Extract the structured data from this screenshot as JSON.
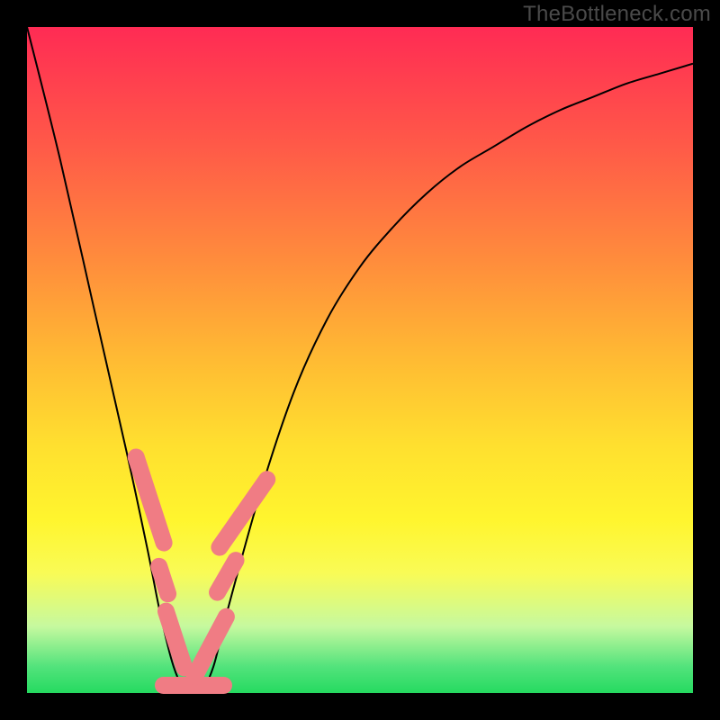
{
  "watermark": "TheBottleneck.com",
  "chart_data": {
    "type": "line",
    "title": "",
    "xlabel": "",
    "ylabel": "",
    "xlim": [
      0,
      100
    ],
    "ylim": [
      0,
      100
    ],
    "series": [
      {
        "name": "bottleneck-curve",
        "x": [
          0,
          5,
          10,
          15,
          18,
          20,
          22,
          24,
          26,
          28,
          30,
          35,
          40,
          45,
          50,
          55,
          60,
          65,
          70,
          75,
          80,
          85,
          90,
          95,
          100
        ],
        "y": [
          100,
          80,
          58,
          36,
          22,
          12,
          4,
          0,
          0,
          4,
          12,
          30,
          45,
          56,
          64,
          70,
          75,
          79,
          82,
          85,
          87.5,
          89.5,
          91.5,
          93,
          94.5
        ]
      }
    ],
    "annotations": [
      {
        "name": "zone-left-upper",
        "x": 18.5,
        "y_center": 29,
        "length": 14,
        "angle": -72
      },
      {
        "name": "zone-left-mid",
        "x": 20.5,
        "y_center": 17,
        "length": 6,
        "angle": -72
      },
      {
        "name": "zone-left-lower",
        "x": 22.3,
        "y_center": 8,
        "length": 10,
        "angle": -72
      },
      {
        "name": "zone-trough",
        "x": 25,
        "y_center": 1.2,
        "length": 10,
        "angle": 0
      },
      {
        "name": "zone-right-lower",
        "x": 27.5,
        "y_center": 7,
        "length": 11,
        "angle": 62
      },
      {
        "name": "zone-right-mid",
        "x": 30,
        "y_center": 17.5,
        "length": 7,
        "angle": 60
      },
      {
        "name": "zone-right-upper",
        "x": 32.5,
        "y_center": 27,
        "length": 13,
        "angle": 55
      }
    ],
    "zone_thickness": 2.6,
    "legend": null,
    "grid": false
  }
}
